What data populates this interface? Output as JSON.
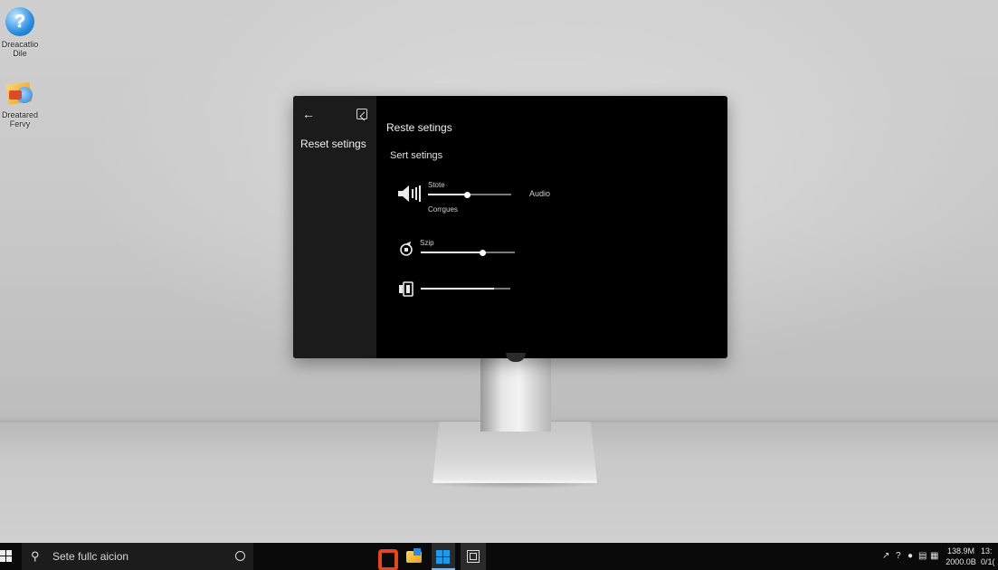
{
  "desktop": {
    "icons": [
      {
        "label_line1": "Dreacatlio",
        "label_line2": "Dile",
        "icon": "help-icon"
      },
      {
        "label_line1": "Dreatared",
        "label_line2": "Fervy",
        "icon": "folder-icon"
      }
    ]
  },
  "settings_window": {
    "side_title": "Reset setings",
    "main_title": "Reste setings",
    "section_title": "Sert setings",
    "controls": [
      {
        "icon": "speaker-icon",
        "label": "Stote",
        "sublabel": "Corrgues",
        "side_label": "Audio",
        "level": 0.47
      },
      {
        "icon": "sync-icon",
        "label": "Szip",
        "level": 0.66
      },
      {
        "icon": "device-icon",
        "level": 0.82
      }
    ]
  },
  "taskbar": {
    "search_placeholder": "Sete fullc aicion",
    "pinned_apps": [
      "office-icon",
      "file-explorer-icon",
      "windows-store-icon",
      "task-view-icon"
    ],
    "tray_icons": [
      "chevron-up-icon",
      "help-icon",
      "volume-icon",
      "network-icon",
      "message-icon"
    ],
    "clock_time": "138.9M",
    "clock_date": "2000.0B",
    "clock_extra_top": "13:",
    "clock_extra_bottom": "0/1("
  }
}
